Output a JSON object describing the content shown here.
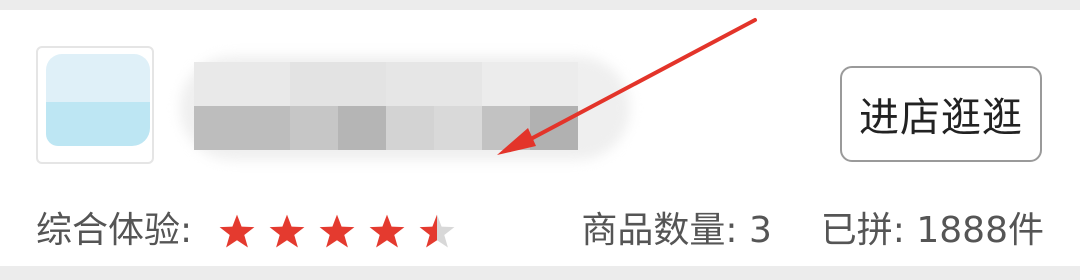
{
  "shop": {
    "visit_button_label": "进店逛逛"
  },
  "rating": {
    "label": "综合体验:",
    "stars": 4.5,
    "star_color": "#e43a2f",
    "empty_star_color": "#d8d8d8"
  },
  "stats": {
    "products_label": "商品数量:",
    "products_value": "3",
    "sold_label": "已拼:",
    "sold_value": "1888件"
  },
  "annotation": {
    "arrow_color": "#e3342a",
    "pointing_to": "blurred-shop-name"
  }
}
